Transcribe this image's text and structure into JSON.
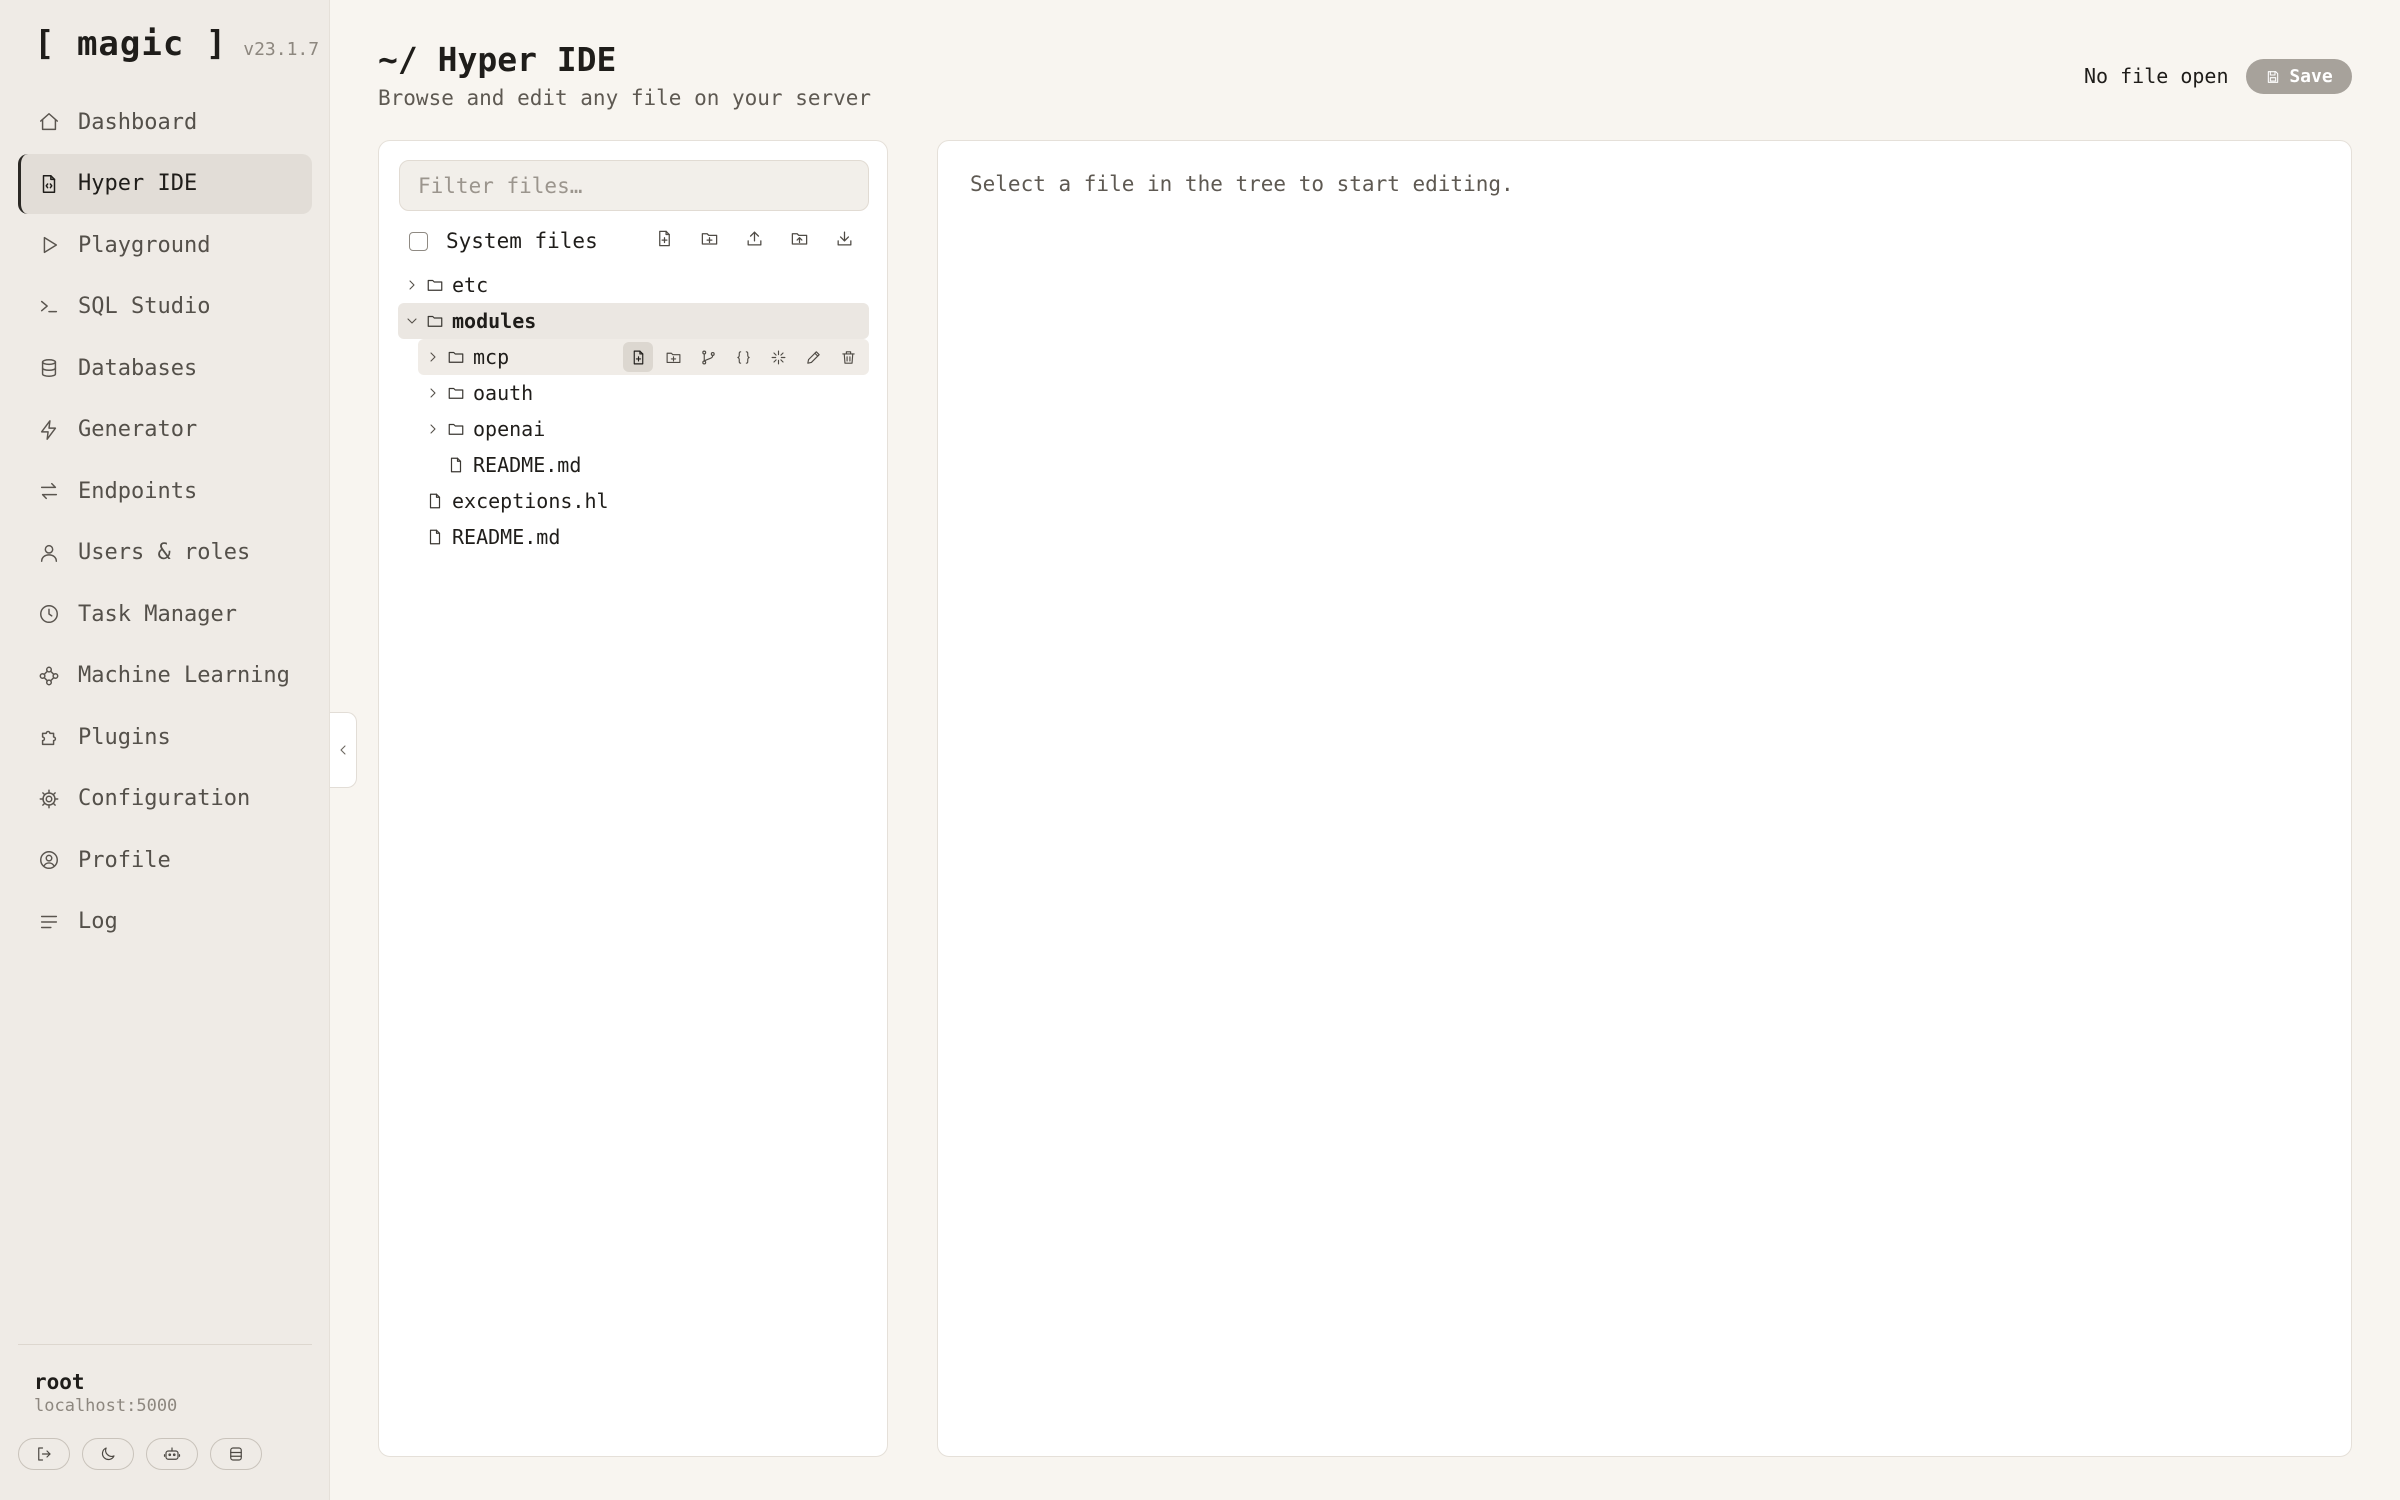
{
  "brand": {
    "logo": "[ magic ]",
    "version": "v23.1.7"
  },
  "nav": {
    "items": [
      {
        "label": "Dashboard",
        "icon": "home-icon"
      },
      {
        "label": "Hyper IDE",
        "icon": "code-file-icon",
        "active": true
      },
      {
        "label": "Playground",
        "icon": "play-icon"
      },
      {
        "label": "SQL Studio",
        "icon": "terminal-icon"
      },
      {
        "label": "Databases",
        "icon": "database-icon"
      },
      {
        "label": "Generator",
        "icon": "bolt-icon"
      },
      {
        "label": "Endpoints",
        "icon": "arrows-icon"
      },
      {
        "label": "Users & roles",
        "icon": "user-icon"
      },
      {
        "label": "Task Manager",
        "icon": "clock-icon"
      },
      {
        "label": "Machine Learning",
        "icon": "network-icon"
      },
      {
        "label": "Plugins",
        "icon": "puzzle-icon"
      },
      {
        "label": "Configuration",
        "icon": "gear-icon"
      },
      {
        "label": "Profile",
        "icon": "profile-circle-icon"
      },
      {
        "label": "Log",
        "icon": "lines-icon"
      }
    ]
  },
  "user": {
    "name": "root",
    "host": "localhost:5000"
  },
  "footer_buttons": [
    "logout-icon",
    "moon-icon",
    "robot-icon",
    "database-icon"
  ],
  "header": {
    "title": "~/ Hyper IDE",
    "subtitle": "Browse and edit any file on your server",
    "file_status": "No file open",
    "save_label": "Save"
  },
  "files": {
    "filter_placeholder": "Filter files…",
    "filter_value": "",
    "system_files_label": "System files",
    "system_files_checked": false,
    "toolbar_icons": [
      "new-file-icon",
      "new-folder-icon",
      "upload-icon",
      "upload-folder-icon",
      "download-icon"
    ],
    "tree": [
      {
        "name": "etc",
        "type": "folder",
        "depth": 0,
        "expanded": false
      },
      {
        "name": "modules",
        "type": "folder",
        "depth": 0,
        "expanded": true,
        "selected": true
      },
      {
        "name": "mcp",
        "type": "folder",
        "depth": 1,
        "expanded": false,
        "hovered": true
      },
      {
        "name": "oauth",
        "type": "folder",
        "depth": 1,
        "expanded": false
      },
      {
        "name": "openai",
        "type": "folder",
        "depth": 1,
        "expanded": false
      },
      {
        "name": "README.md",
        "type": "file",
        "depth": 1
      },
      {
        "name": "exceptions.hl",
        "type": "file",
        "depth": 0
      },
      {
        "name": "README.md",
        "type": "file",
        "depth": 0
      }
    ],
    "row_actions": [
      "new-file-icon",
      "new-folder-icon",
      "branch-icon",
      "braces-icon",
      "sparkle-icon",
      "pencil-icon",
      "trash-icon"
    ]
  },
  "editor": {
    "placeholder_text": "Select a file in the tree to start editing."
  },
  "colors": {
    "background": "#f8f5f0",
    "sidebar": "#efebe6",
    "save_button": "#a7a29b",
    "text": "#1f1d1a"
  }
}
